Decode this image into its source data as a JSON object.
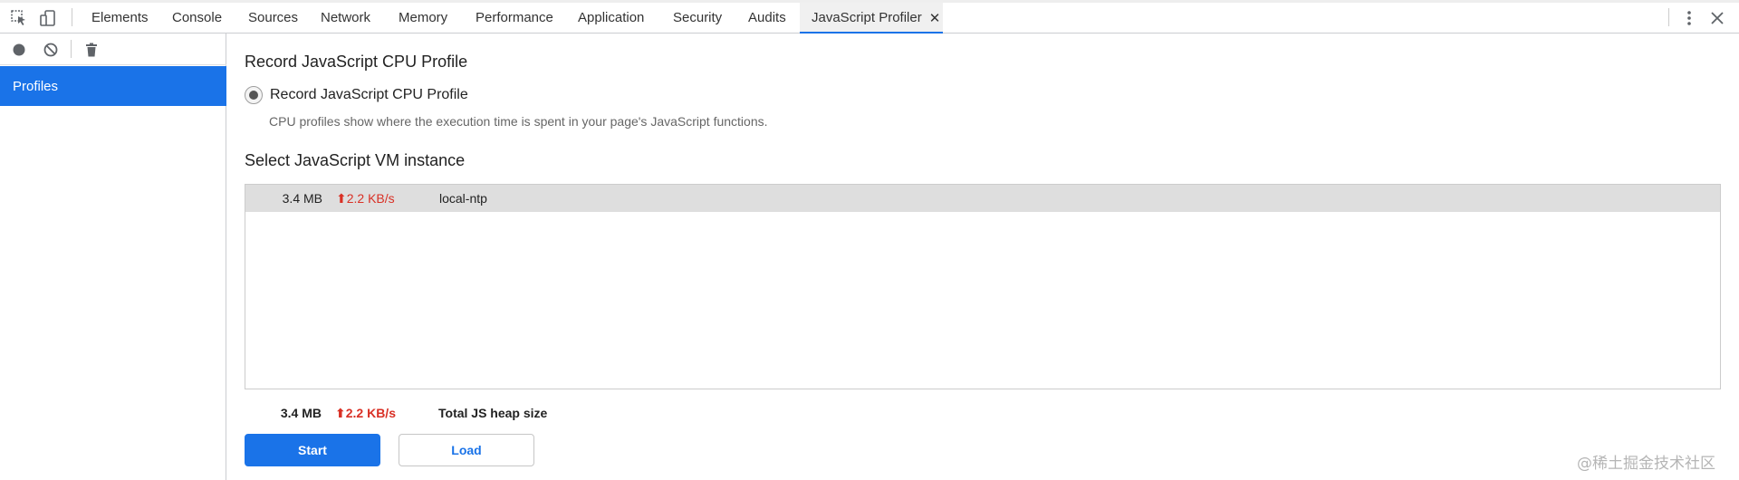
{
  "tabs": [
    {
      "label": "Elements"
    },
    {
      "label": "Console"
    },
    {
      "label": "Sources"
    },
    {
      "label": "Network"
    },
    {
      "label": "Memory"
    },
    {
      "label": "Performance"
    },
    {
      "label": "Application"
    },
    {
      "label": "Security"
    },
    {
      "label": "Audits"
    },
    {
      "label": "JavaScript Profiler",
      "active": true,
      "close": "✕"
    }
  ],
  "toolbar_icons": [
    "inspect-element-icon",
    "device-toggle-icon",
    "more-menu-icon",
    "close-devtools-icon"
  ],
  "sidebar": {
    "icons": [
      "record-icon",
      "clear-icon",
      "delete-icon"
    ],
    "items": [
      {
        "label": "Profiles",
        "selected": true
      }
    ]
  },
  "main": {
    "section_title": "Record JavaScript CPU Profile",
    "radio_label": "Record JavaScript CPU Profile",
    "radio_description": "CPU profiles show where the execution time is spent in your page's JavaScript functions.",
    "vm_title": "Select JavaScript VM instance",
    "vm_instances": [
      {
        "size": "3.4 MB",
        "rate": "⬆2.2 KB/s",
        "name": "local-ntp"
      }
    ],
    "summary": {
      "size": "3.4 MB",
      "rate": "⬆2.2 KB/s",
      "label": "Total JS heap size"
    },
    "start_button": "Start",
    "load_button": "Load"
  },
  "watermark": "@稀土掘金技术社区",
  "colors": {
    "accent": "#1a73e8",
    "rate_red": "#d93025"
  }
}
